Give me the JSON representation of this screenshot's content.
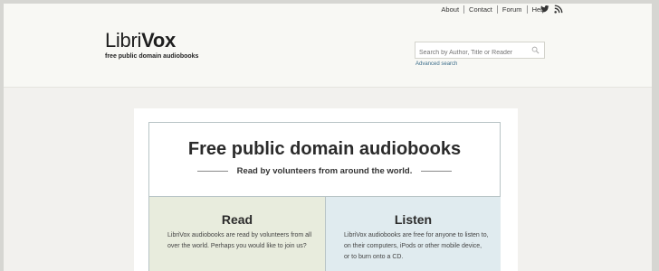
{
  "nav": {
    "links": [
      "About",
      "Contact",
      "Forum",
      "Help"
    ]
  },
  "social": {
    "icons": [
      "twitter-icon",
      "rss-icon"
    ]
  },
  "logo": {
    "libri": "Libri",
    "vox": "Vox",
    "tagline": "free public domain audiobooks"
  },
  "search": {
    "placeholder": "Search by Author, Title or Reader",
    "advanced": "Advanced search"
  },
  "hero": {
    "title": "Free public domain audiobooks",
    "subtitle": "Read by volunteers from around the world."
  },
  "read": {
    "heading": "Read",
    "text": "LibriVox audiobooks are read by volunteers from all over the world. Perhaps you would like to join us?"
  },
  "listen": {
    "heading": "Listen",
    "text": "LibriVox audiobooks are free for anyone to listen to, on their computers, iPods or other mobile device, or to burn onto a CD."
  }
}
